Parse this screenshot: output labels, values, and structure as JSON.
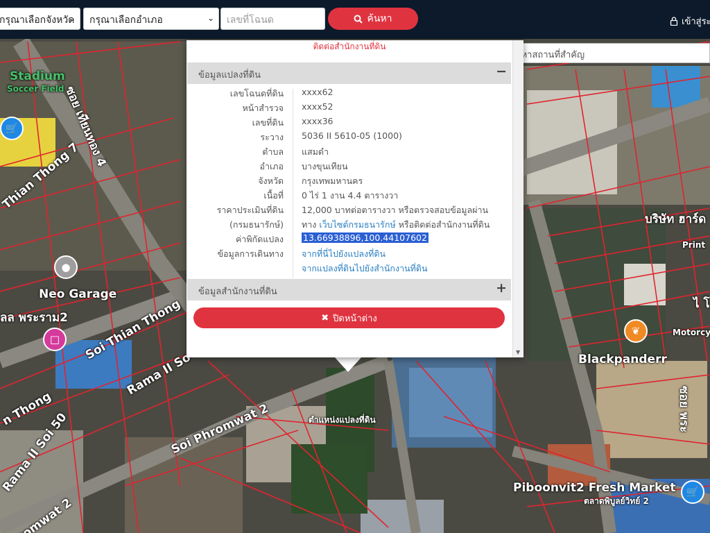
{
  "topbar": {
    "province_select": "กรุณาเลือกจังหวัด",
    "district_select": "กรุณาเลือกอำเภอ",
    "deed_input_placeholder": "เลขที่โฉนด",
    "search_button": "ค้นหา",
    "login_link": "เข้าสู่ระ"
  },
  "landmark_search": {
    "placeholder": "ค้นหาสถานที่สำคัญ"
  },
  "popup": {
    "contact_top": "ติดต่อสำนักงานที่ดิน",
    "info_header": "ข้อมูลแปลงที่ดิน",
    "info_toggle": "−",
    "rows": [
      {
        "label": "เลขโฉนดที่ดิน",
        "value": "xxxx62"
      },
      {
        "label": "หน้าสำรวจ",
        "value": "xxxx52"
      },
      {
        "label": "เลขที่ดิน",
        "value": "xxxx36"
      },
      {
        "label": "ระวาง",
        "value": "5036 II 5610-05 (1000)"
      },
      {
        "label": "ตำบล",
        "value": "แสมดำ"
      },
      {
        "label": "อำเภอ",
        "value": "บางขุนเทียน"
      },
      {
        "label": "จังหวัด",
        "value": "กรุงเทพมหานคร"
      },
      {
        "label": "เนื้อที่",
        "value": "0 ไร่ 1 งาน 4.4 ตารางวา"
      },
      {
        "label": "ราคาประเมินที่ดิน",
        "value": "12,000 บาทต่อตารางวา หรือตรวจสอบข้อมูลผ่าน"
      },
      {
        "label": "(กรมธนารักษ์)",
        "value_pre": "ทาง ",
        "value_link": "เว็บไซต์กรมธนารักษ์",
        "value_post": " หรือติดต่อสำนักงานที่ดิน"
      },
      {
        "label": "ค่าพิกัดแปลง",
        "value_highlight": "13.66938896,100.44107602"
      },
      {
        "label": "ข้อมูลการเดินทาง",
        "value_link": "จากที่นี่ไปยังแปลงที่ดิน"
      },
      {
        "label": "",
        "value_link": "จากแปลงที่ดินไปยังสำนักงานที่ดิน"
      }
    ],
    "office_header": "ข้อมูลสำนักงานที่ดิน",
    "office_toggle": "+",
    "close_button": "ปิดหน้าต่าง"
  },
  "map": {
    "labels": {
      "stadium": "Stadium",
      "soccer_field": "Soccer Field",
      "soi_thian_thong_4": "ซอย เทียนทอง 4",
      "thian_thong_7": "Thian Thong 7",
      "neo_garage": "Neo Garage",
      "rama2": "ลล พระราม2",
      "soi_thian_thong": "Soi Thian Thong",
      "thong": "n Thong",
      "rama_ii_soi_50": "Rama II Soi 50",
      "ramali": "Rama II So",
      "soi_phromwat_2": "Soi Phromwat 2",
      "phromwat_2": "romwat 2",
      "land_pin_label": "ตำแหน่งแปลงที่ดิน",
      "blackpanderr": "Blackpanderr",
      "piboonvit": "Piboonvit2 Fresh Market",
      "piboonvit_th": "ตลาดพิบูลย์วิทย์ 2",
      "bor_ror_sor": "บริษัท ฮาร์ด",
      "print": "Print",
      "motorcyc": "Motorcyc",
      "soi_right": "ซอย พระ",
      "north_th": "ไ โ"
    }
  },
  "colors": {
    "accent": "#e03340",
    "topbar": "#0c1a2b",
    "link": "#2a7fc1",
    "parcel_line": "#e0242f"
  }
}
